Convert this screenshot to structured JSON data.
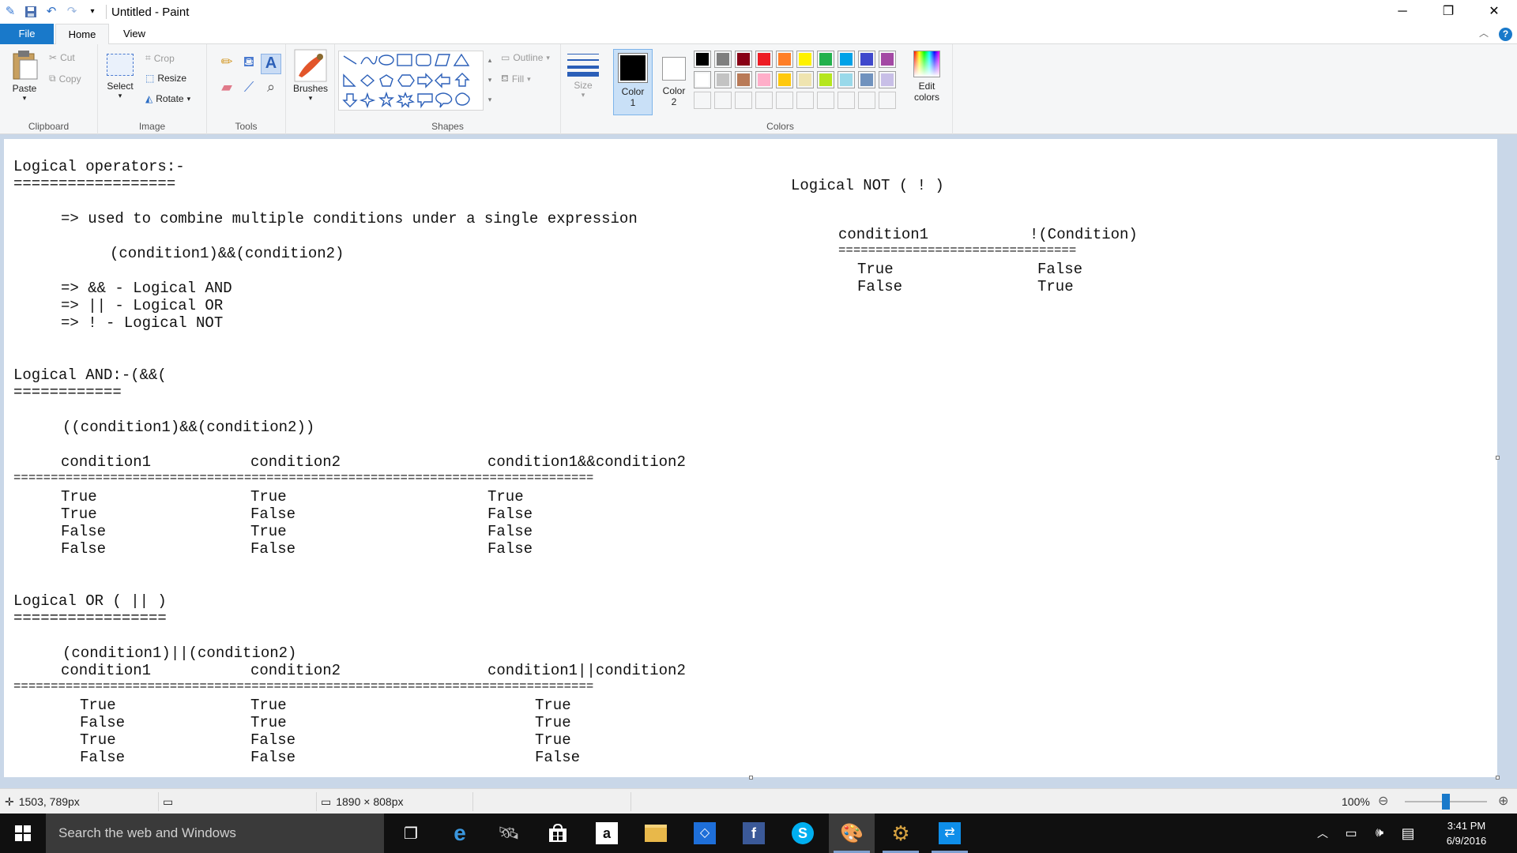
{
  "window": {
    "title": "Untitled - Paint",
    "quick_access": [
      "paint-icon",
      "save-icon",
      "undo-icon",
      "redo-icon",
      "customize-icon"
    ],
    "controls": [
      "minimize-icon",
      "restore-icon",
      "close-icon"
    ]
  },
  "tabs": {
    "file": "File",
    "home": "Home",
    "view": "View"
  },
  "ribbon": {
    "clipboard": {
      "label": "Clipboard",
      "paste": "Paste",
      "cut": "Cut",
      "copy": "Copy"
    },
    "image": {
      "label": "Image",
      "select": "Select",
      "crop": "Crop",
      "resize": "Resize",
      "rotate": "Rotate"
    },
    "tools": {
      "label": "Tools"
    },
    "brushes": {
      "label": "Brushes"
    },
    "shapes": {
      "label": "Shapes",
      "outline": "Outline",
      "fill": "Fill"
    },
    "size": {
      "label": "Size"
    },
    "colors": {
      "label": "Colors",
      "color1_line1": "Color",
      "color1_line2": "1",
      "color2_line1": "Color",
      "color2_line2": "2",
      "color1_value": "#000000",
      "color2_value": "#ffffff",
      "edit_line1": "Edit",
      "edit_line2": "colors",
      "palette_row1": [
        "#000000",
        "#7f7f7f",
        "#880015",
        "#ed1c24",
        "#ff7f27",
        "#fff200",
        "#22b14c",
        "#00a2e8",
        "#3f48cc",
        "#a349a4"
      ],
      "palette_row2": [
        "#ffffff",
        "#c3c3c3",
        "#b97a57",
        "#ffaec9",
        "#ffc90e",
        "#efe4b0",
        "#b5e61d",
        "#99d9ea",
        "#7092be",
        "#c8bfe7"
      ]
    }
  },
  "canvas_text": {
    "heading_ops": "Logical operators:-",
    "underline_ops": "==================",
    "ops_line1": "=> used to combine multiple conditions under a single expression",
    "ops_example": "(condition1)&&(condition2)",
    "ops_and": "=> && - Logical AND",
    "ops_or": "=> || - Logical OR",
    "ops_not": "=> ! - Logical NOT",
    "heading_and": "Logical AND:-(&&(",
    "underline_and": "============",
    "and_example": "((condition1)&&(condition2))",
    "and_headers": [
      "condition1",
      "condition2",
      "condition1&&condition2"
    ],
    "and_rule": "==============================================================================",
    "and_col1": [
      "True",
      "True",
      "False",
      "False"
    ],
    "and_col2": [
      "True",
      "False",
      "True",
      "False"
    ],
    "and_col3": [
      "True",
      "False",
      "False",
      "False"
    ],
    "heading_or": "Logical OR ( || )",
    "underline_or": "=================",
    "or_example": "(condition1)||(condition2)",
    "or_headers": [
      "condition1",
      "condition2",
      "condition1||condition2"
    ],
    "or_rule": "==============================================================================",
    "or_col1": [
      "True",
      "False",
      "True",
      "False"
    ],
    "or_col2": [
      "True",
      "True",
      "False",
      "False"
    ],
    "or_col3": [
      "True",
      "True",
      "True",
      "False"
    ],
    "heading_not": "Logical NOT ( ! )",
    "not_headers": [
      "condition1",
      "!(Condition)"
    ],
    "not_rule": "================================",
    "not_col1": [
      "True",
      "False"
    ],
    "not_col2": [
      "False",
      "True"
    ]
  },
  "status": {
    "cursor_pos": "1503, 789px",
    "canvas_size": "1890 × 808px",
    "zoom": "100%",
    "zoom_level": 0.5
  },
  "taskbar": {
    "search_placeholder": "Search the web and Windows",
    "time": "3:41 PM",
    "date": "6/9/2016"
  }
}
